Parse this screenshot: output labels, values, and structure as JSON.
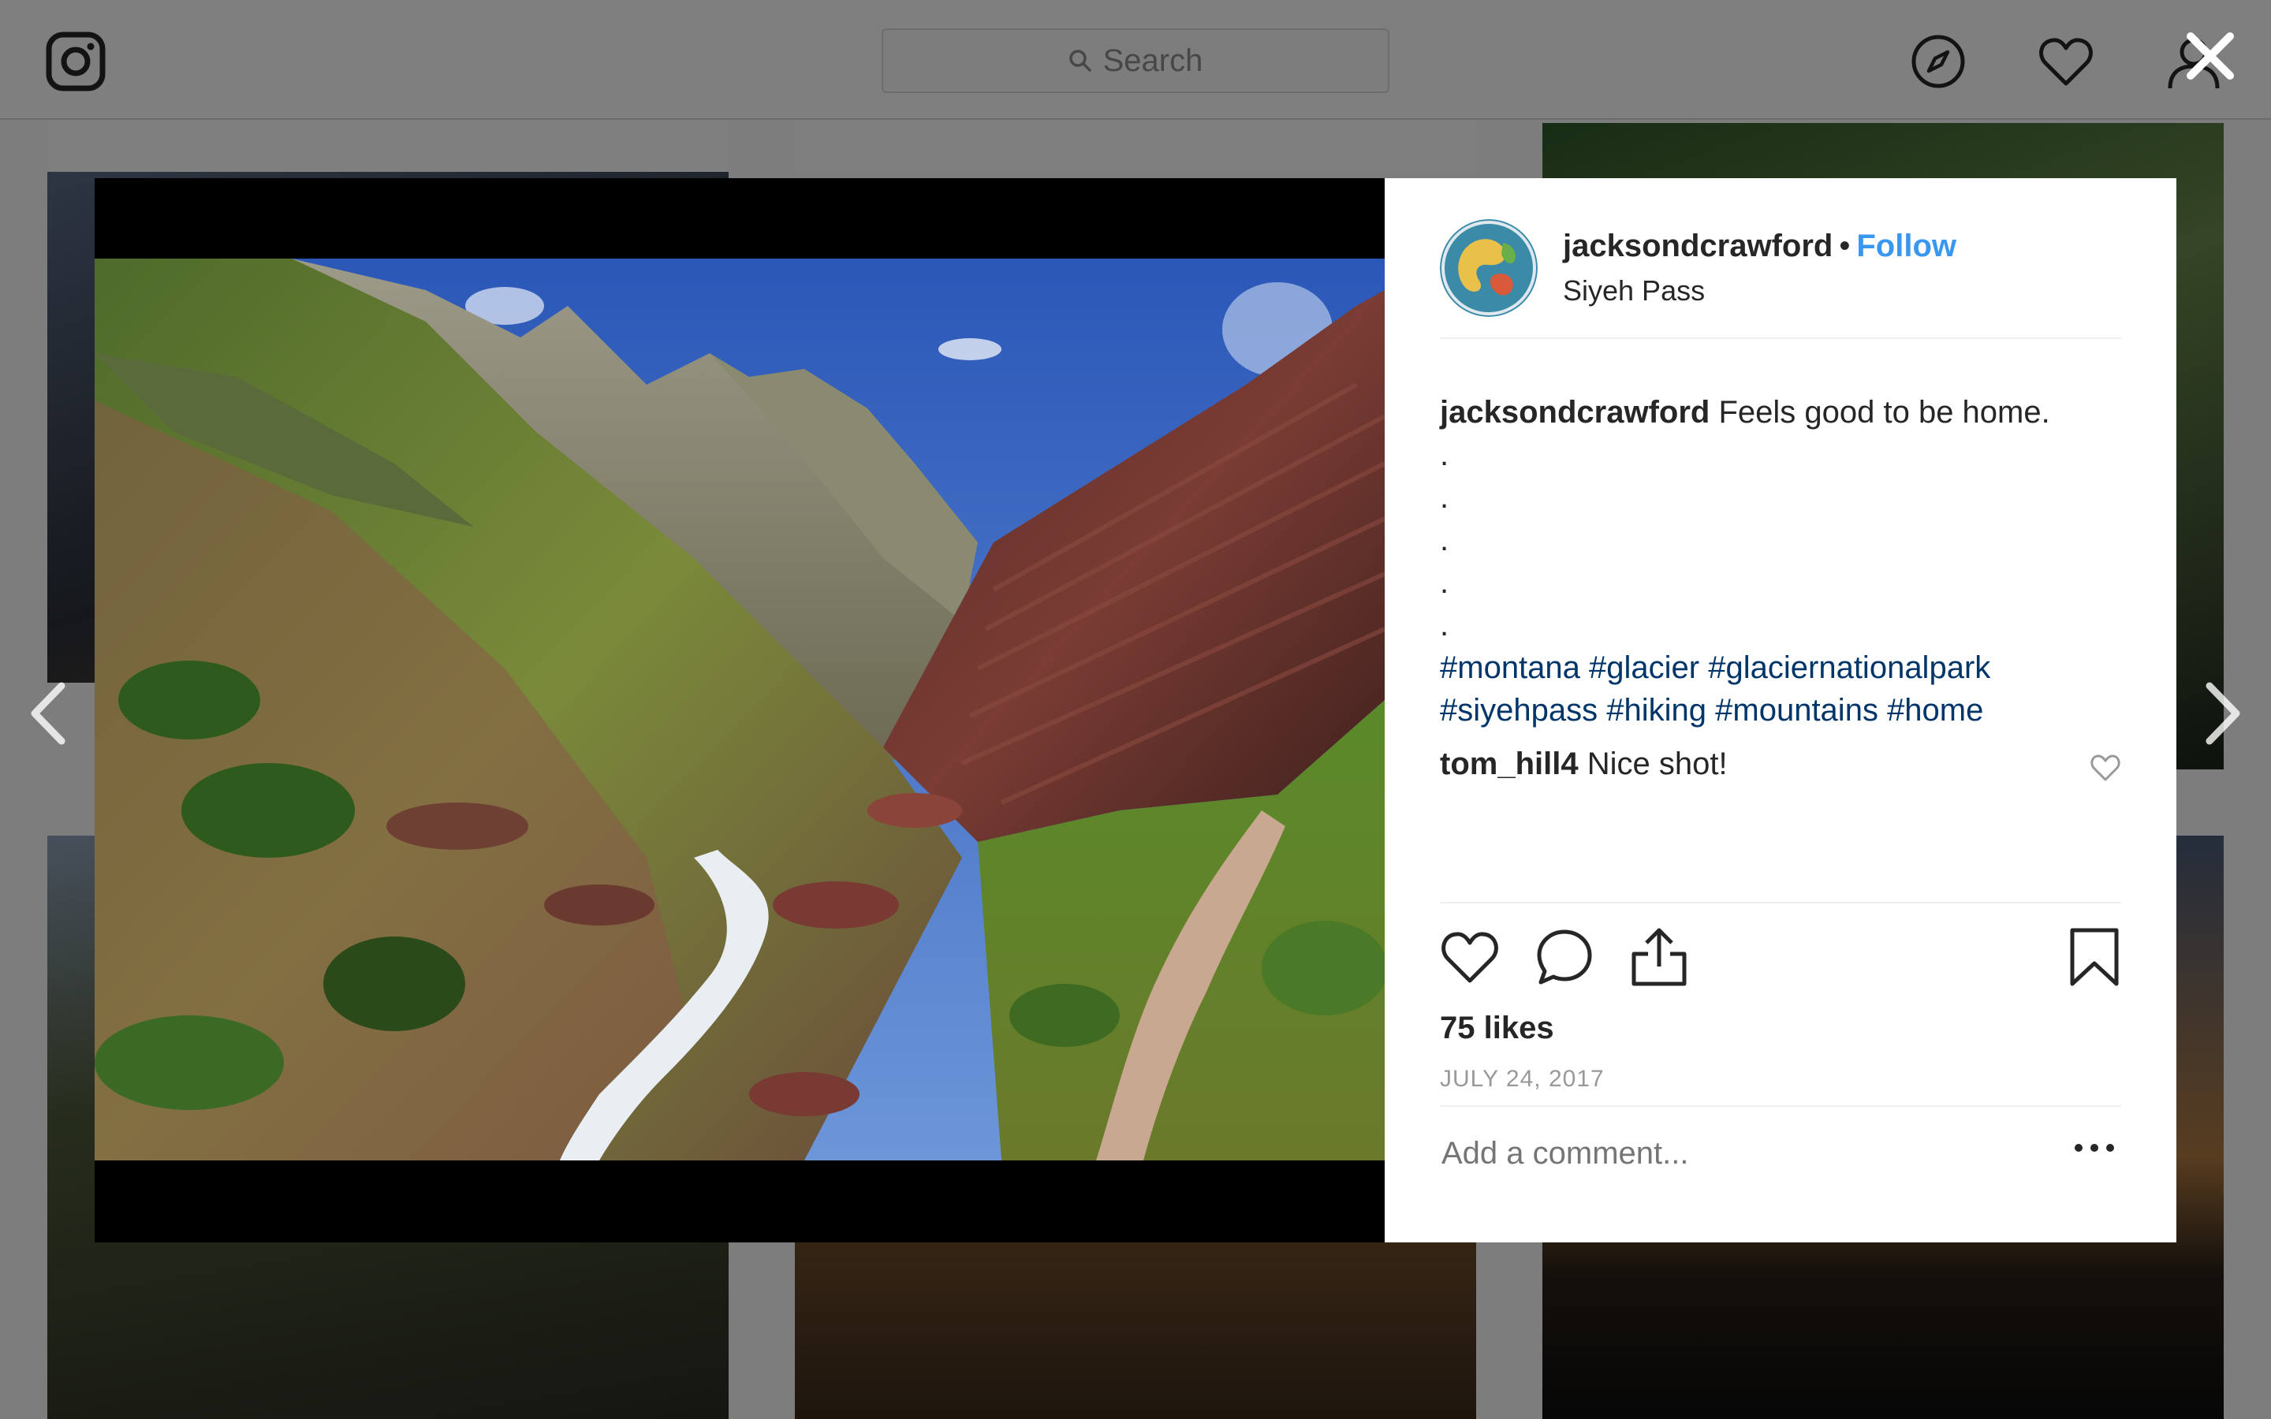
{
  "topbar": {
    "search_placeholder": "Search"
  },
  "icons": {
    "logo": "instagram-logo",
    "explore": "compass-icon",
    "activity": "heart-icon",
    "profile": "user-icon",
    "close": "close-icon",
    "prev": "chevron-left-icon",
    "next": "chevron-right-icon"
  },
  "post": {
    "username": "jacksondcrawford",
    "separator": "•",
    "follow_label": "Follow",
    "location": "Siyeh Pass",
    "caption_user": "jacksondcrawford",
    "caption_text": "Feels good to be home.",
    "caption_dots": [
      ".",
      ".",
      ".",
      ".",
      "."
    ],
    "hashtags_line1": [
      "#montana",
      "#glacier",
      "#glaciernationalpark"
    ],
    "hashtags_line2": [
      "#siyehpass",
      "#hiking",
      "#mountains",
      "#home"
    ],
    "comments": [
      {
        "user": "tom_hill4",
        "text": "Nice shot!"
      }
    ],
    "likes": "75 likes",
    "date": "JULY 24, 2017",
    "add_comment_placeholder": "Add a comment..."
  },
  "colors": {
    "link": "#3897f0",
    "hashtag": "#003569",
    "text": "#262626",
    "muted": "#999999"
  }
}
